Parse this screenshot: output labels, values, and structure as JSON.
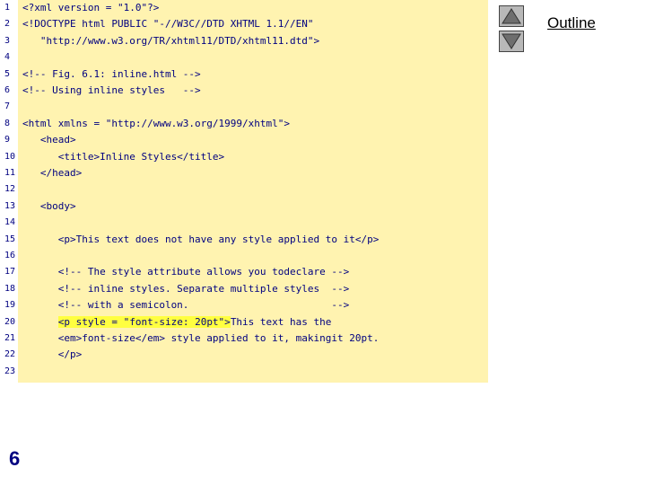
{
  "nav": {
    "outline_label": "Outline",
    "prev_icon": "triangle-up-icon",
    "next_icon": "triangle-down-icon"
  },
  "slide": {
    "number": "6"
  },
  "code": {
    "lines": [
      {
        "n": "1",
        "text": "<?xml version = \"1.0\"?>"
      },
      {
        "n": "2",
        "text": "<!DOCTYPE html PUBLIC \"-//W3C//DTD XHTML 1.1//EN\""
      },
      {
        "n": "3",
        "text": "   \"http://www.w3.org/TR/xhtml11/DTD/xhtml11.dtd\">"
      },
      {
        "n": "4",
        "text": ""
      },
      {
        "n": "5",
        "text": "<!-- Fig. 6.1: inline.html -->"
      },
      {
        "n": "6",
        "text": "<!-- Using inline styles   -->"
      },
      {
        "n": "7",
        "text": ""
      },
      {
        "n": "8",
        "text": "<html xmlns = \"http://www.w3.org/1999/xhtml\">"
      },
      {
        "n": "9",
        "text": "   <head>"
      },
      {
        "n": "10",
        "text": "      <title>Inline Styles</title>"
      },
      {
        "n": "11",
        "text": "   </head>"
      },
      {
        "n": "12",
        "text": ""
      },
      {
        "n": "13",
        "text": "   <body>"
      },
      {
        "n": "14",
        "text": ""
      },
      {
        "n": "15",
        "text": "      <p>This text does not have any style applied to it</p>"
      },
      {
        "n": "16",
        "text": ""
      },
      {
        "n": "17",
        "text": "      <!-- The style attribute allows you todeclare -->"
      },
      {
        "n": "18",
        "text": "      <!-- inline styles. Separate multiple styles  -->"
      },
      {
        "n": "19",
        "text": "      <!-- with a semicolon.                        -->"
      },
      {
        "n": "20",
        "text": "",
        "hl": "<p style = \"font-size: 20pt\">",
        "rest": "This text has the"
      },
      {
        "n": "21",
        "text": "      <em>font-size</em> style applied to it, makingit 20pt."
      },
      {
        "n": "22",
        "text": "      </p>"
      },
      {
        "n": "23",
        "text": ""
      }
    ]
  }
}
